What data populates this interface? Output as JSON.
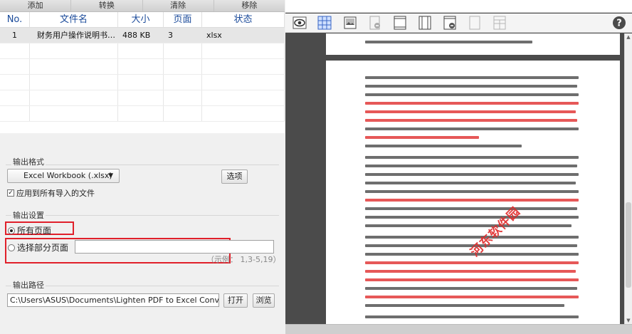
{
  "toolbar": {
    "add": "添加",
    "convert": "转换",
    "clear": "清除",
    "remove": "移除"
  },
  "table": {
    "headers": {
      "no": "No.",
      "name": "文件名",
      "size": "大小",
      "pages": "页面",
      "state": "状态"
    },
    "rows": [
      {
        "no": "1",
        "name": "财务用户操作说明书.xlsx",
        "size": "488 KB",
        "pages": "3",
        "state": "xlsx"
      }
    ]
  },
  "output_format": {
    "label": "输出格式",
    "selected": "Excel Workbook (.xlsx)",
    "preview_button": "选项",
    "apply_all_label": "应用到所有导入的文件",
    "apply_all_checked": true
  },
  "output_settings": {
    "label": "输出设置",
    "all_pages_label": "所有页面",
    "partial_pages_label": "选择部分页面",
    "selected": "all_pages",
    "range_value": "",
    "example": "（示例： 1,3-5,19）"
  },
  "output_path": {
    "label": "输出路径",
    "value": "C:\\Users\\ASUS\\Documents\\Lighten PDF to Excel Converter",
    "open_button": "打开",
    "browse_button": "浏览"
  },
  "viewer": {
    "watermark": "河东软件园",
    "colors": {
      "highlight": "#e02a2a",
      "accent": "#1a4a9a",
      "selection": "#e0202a"
    },
    "icons": [
      "eye-icon",
      "grid-icon",
      "image-icon",
      "remove-page-icon",
      "single-page-icon",
      "two-page-icon",
      "delete-page-icon",
      "blank-page-icon",
      "table-page-icon",
      "help-icon"
    ]
  }
}
